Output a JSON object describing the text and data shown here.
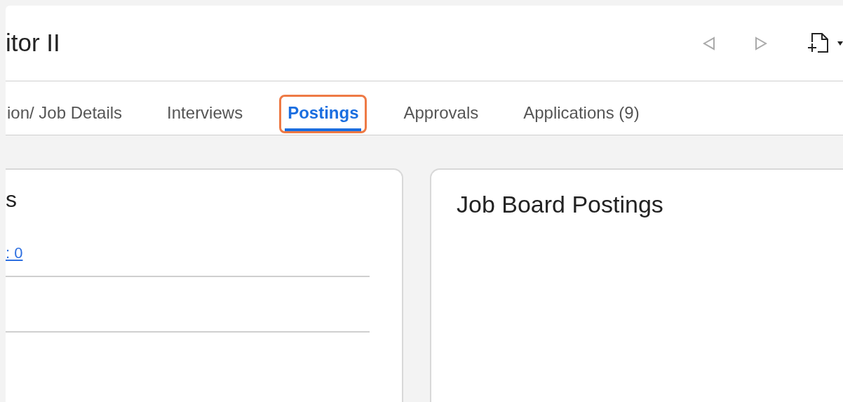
{
  "header": {
    "title": "itor II"
  },
  "tabs": [
    {
      "label": "ion/ Job Details",
      "selected": false
    },
    {
      "label": "Interviews",
      "selected": false
    },
    {
      "label": "Postings",
      "selected": true
    },
    {
      "label": "Approvals",
      "selected": false
    },
    {
      "label": "Applications (9)",
      "selected": false
    }
  ],
  "left_card": {
    "title": "s",
    "link": ": 0"
  },
  "right_card": {
    "title": "Job Board Postings"
  }
}
